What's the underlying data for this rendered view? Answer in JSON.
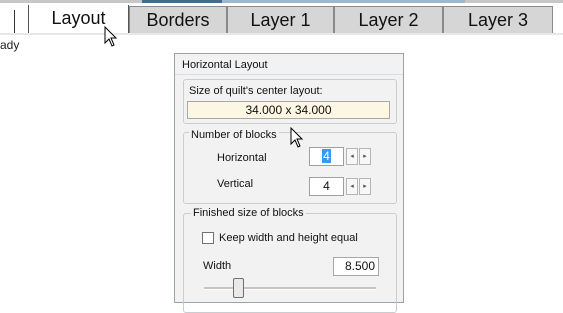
{
  "tabs": [
    {
      "label": "Layout",
      "active": true
    },
    {
      "label": "Borders",
      "active": false
    },
    {
      "label": "Layer 1",
      "active": false
    },
    {
      "label": "Layer 2",
      "active": false
    },
    {
      "label": "Layer 3",
      "active": false
    }
  ],
  "status": {
    "text": "ady"
  },
  "panel": {
    "title": "Horizontal Layout",
    "center_size_label": "Size of quilt's center layout:",
    "center_size_value": "34.000 x 34.000",
    "blocks_group_label": "Number of blocks",
    "horizontal_label": "Horizontal",
    "horizontal_value": "4",
    "vertical_label": "Vertical",
    "vertical_value": "4",
    "finished_group_label": "Finished size of blocks",
    "keep_equal_label": "Keep width and height equal",
    "keep_equal_checked": false,
    "width_label": "Width",
    "width_value": "8.500",
    "width_slider_level": 0.18
  },
  "icons": {
    "cursor": "arrow-cursor-icon",
    "spin_left": "◂",
    "spin_right": "▸"
  },
  "colors": {
    "selection": "#3399ff",
    "inactive_tab": "#d6d6d6",
    "size_box_bg": "#fdf6e3"
  }
}
